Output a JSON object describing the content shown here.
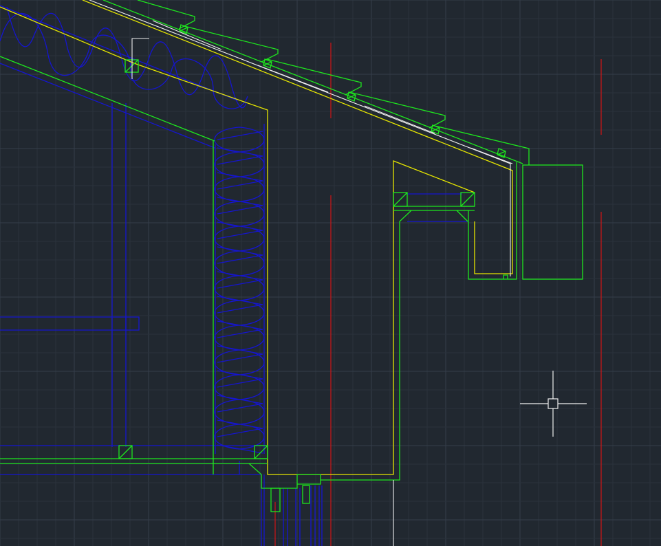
{
  "app": {
    "view": "model-space",
    "cursor": "crosshair-pickbox"
  },
  "colors": {
    "background": "#212830",
    "grid_minor": "#2a323c",
    "grid_major": "#353e4a",
    "blue": "#1515d0",
    "green": "#1ee61e",
    "yellow": "#e6e600",
    "red": "#d01515",
    "white": "#f0f0f0"
  },
  "layers": [
    {
      "name": "insulation",
      "color": "blue"
    },
    {
      "name": "timber",
      "color": "green"
    },
    {
      "name": "finish-outline",
      "color": "yellow"
    },
    {
      "name": "reference-lines",
      "color": "red"
    },
    {
      "name": "flashing",
      "color": "white"
    }
  ]
}
